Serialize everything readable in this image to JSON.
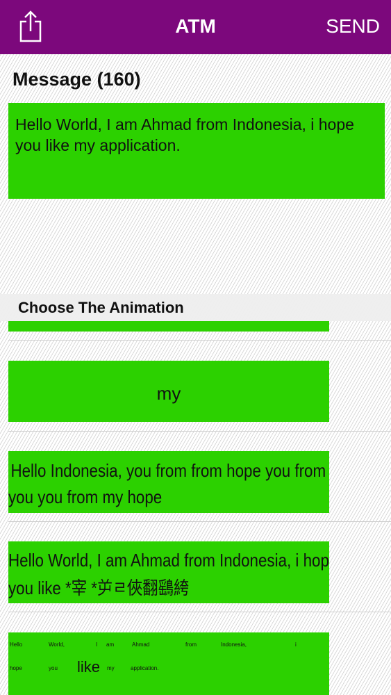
{
  "navbar": {
    "title": "ATM",
    "send_label": "SEND",
    "share_icon": "share-icon",
    "color": "#7c087c"
  },
  "message": {
    "label": "Message (160)",
    "text": "Hello World, I am Ahmad from Indonesia, i hope you like my application.",
    "box_color": "#2cd100"
  },
  "animations": {
    "header": "Choose The Animation",
    "items": [
      {
        "text": ""
      },
      {
        "text": "my"
      },
      {
        "line1": "Hello Indonesia, you from from hope you from",
        "line2": "you you from my hope"
      },
      {
        "line1": "Hello World, I am Ahmad from Indonesia, i hope",
        "line2": "you like *宰 *屰ㄹ俠翻鷂絝"
      },
      {
        "words": [
          "Hello",
          "World,",
          "I",
          "am",
          "Ahmad",
          "from",
          "Indonesia,",
          "i",
          "hope",
          "you",
          "like",
          "my",
          "application."
        ]
      }
    ]
  }
}
